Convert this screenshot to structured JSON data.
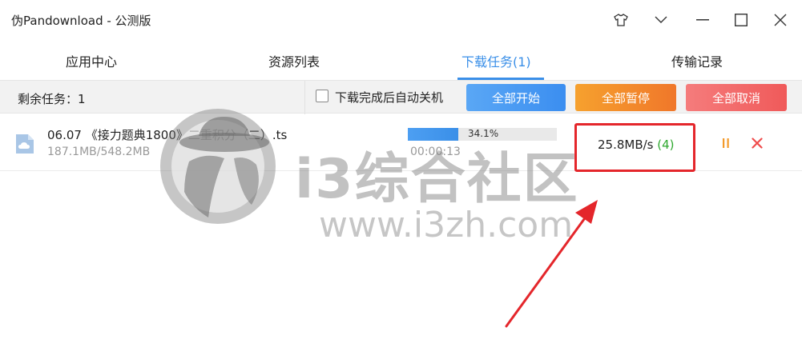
{
  "window": {
    "title": "伪Pandownload - 公测版"
  },
  "tabs": [
    {
      "label": "应用中心",
      "active": false
    },
    {
      "label": "资源列表",
      "active": false
    },
    {
      "label": "下载任务(1)",
      "active": true
    },
    {
      "label": "传输记录",
      "active": false
    }
  ],
  "toolbar": {
    "remaining": "剩余任务：1",
    "auto_shutdown_label": "下载完成后自动关机",
    "start_all": "全部开始",
    "pause_all": "全部暂停",
    "cancel_all": "全部取消"
  },
  "download": {
    "name": "06.07 《接力题典1800》二重积分（二）.ts",
    "size": "187.1MB/548.2MB",
    "progress_percent": 34.1,
    "progress_label": "34.1%",
    "elapsed": "00:00:13",
    "speed": "25.8MB/s",
    "connections": "(4)"
  },
  "watermark": {
    "text": "i3综合社区",
    "url": "www.i3zh.com"
  },
  "colors": {
    "accent": "#3a8fe8",
    "start": "#4a9bf2",
    "pause": "#f38a2c",
    "cancel": "#f36a6a",
    "highlight": "#e4262b",
    "connections": "#2ea82e"
  },
  "icons": [
    "tshirt-icon",
    "chevron-down-icon",
    "minimize-icon",
    "maximize-icon",
    "close-icon",
    "file-cloud-icon",
    "pause-icon",
    "cancel-icon"
  ]
}
